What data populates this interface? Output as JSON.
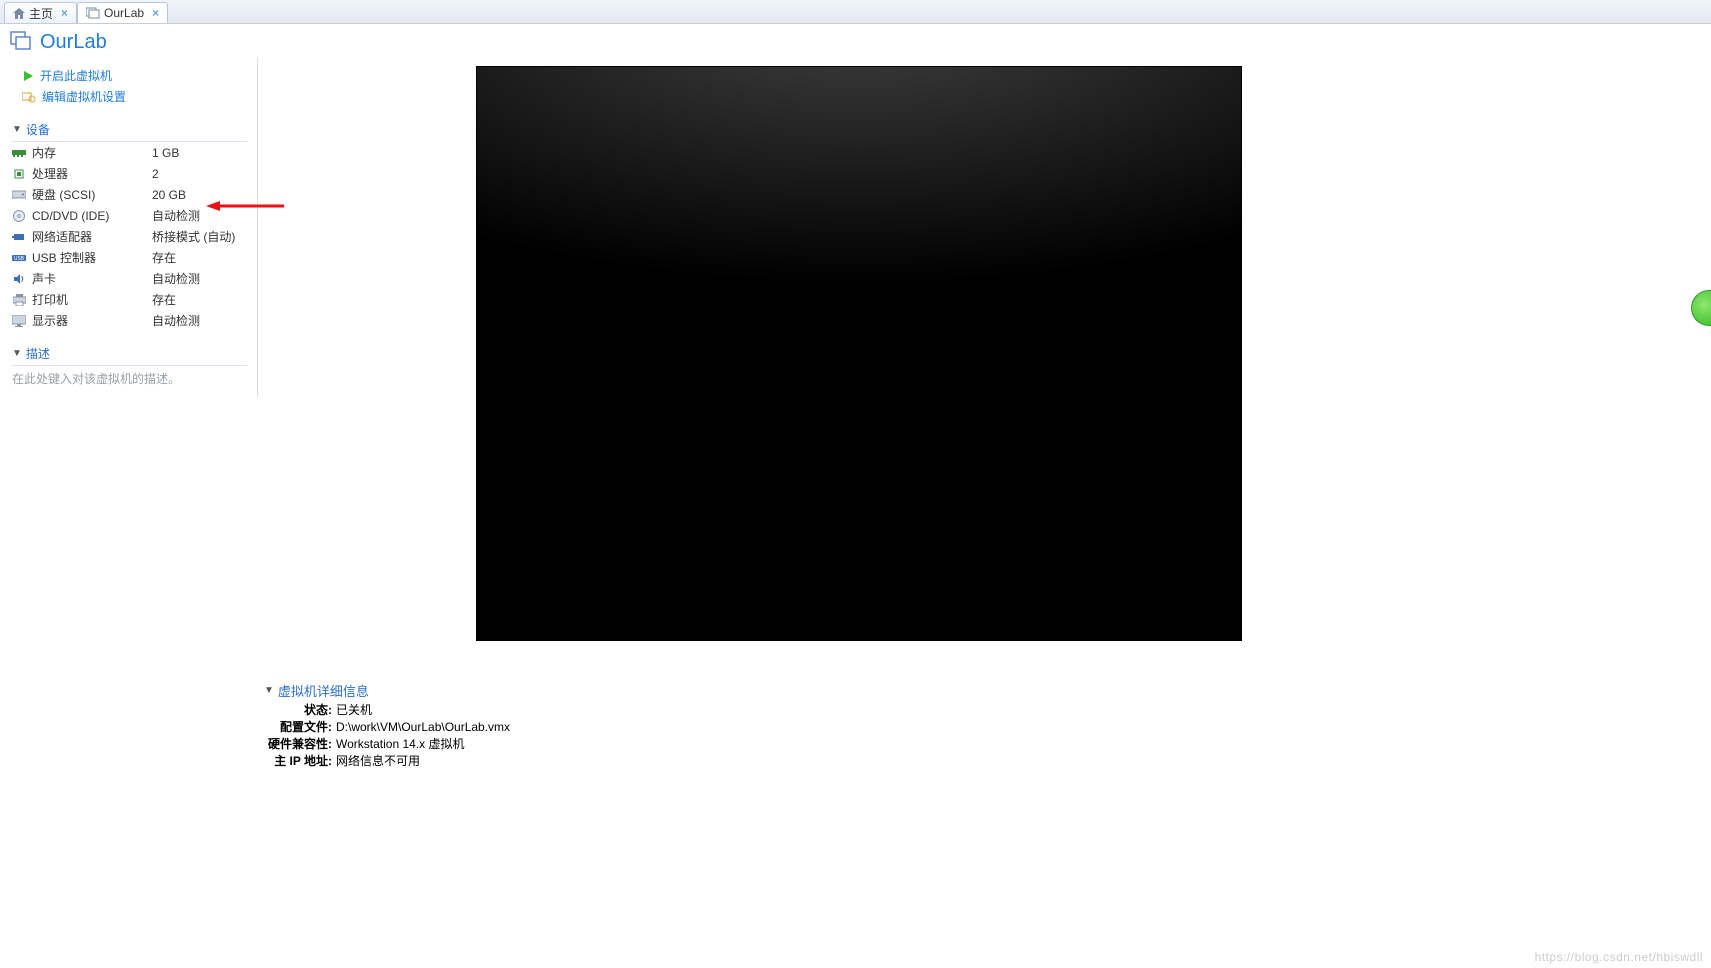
{
  "tabs": [
    {
      "label": "主页",
      "icon": "home-icon"
    },
    {
      "label": "OurLab",
      "icon": "vm-icon"
    }
  ],
  "title": "OurLab",
  "actions": {
    "power_on": "开启此虚拟机",
    "edit_settings": "编辑虚拟机设置"
  },
  "sections": {
    "devices_header": "设备",
    "description_header": "描述",
    "description_placeholder": "在此处键入对该虚拟机的描述。"
  },
  "devices": [
    {
      "icon": "memory-icon",
      "label": "内存",
      "value": "1 GB"
    },
    {
      "icon": "cpu-icon",
      "label": "处理器",
      "value": "2"
    },
    {
      "icon": "disk-icon",
      "label": "硬盘 (SCSI)",
      "value": "20 GB"
    },
    {
      "icon": "cd-icon",
      "label": "CD/DVD (IDE)",
      "value": "自动检测"
    },
    {
      "icon": "network-icon",
      "label": "网络适配器",
      "value": "桥接模式 (自动)"
    },
    {
      "icon": "usb-icon",
      "label": "USB 控制器",
      "value": "存在"
    },
    {
      "icon": "sound-icon",
      "label": "声卡",
      "value": "自动检测"
    },
    {
      "icon": "printer-icon",
      "label": "打印机",
      "value": "存在"
    },
    {
      "icon": "display-icon",
      "label": "显示器",
      "value": "自动检测"
    }
  ],
  "details": {
    "header": "虚拟机详细信息",
    "rows": [
      {
        "key": "状态:",
        "value": "已关机"
      },
      {
        "key": "配置文件:",
        "value": "D:\\work\\VM\\OurLab\\OurLab.vmx"
      },
      {
        "key": "硬件兼容性:",
        "value": "Workstation 14.x 虚拟机"
      },
      {
        "key": "主 IP 地址:",
        "value": "网络信息不可用"
      }
    ]
  },
  "watermark": "https://blog.csdn.net/hbiswdll"
}
